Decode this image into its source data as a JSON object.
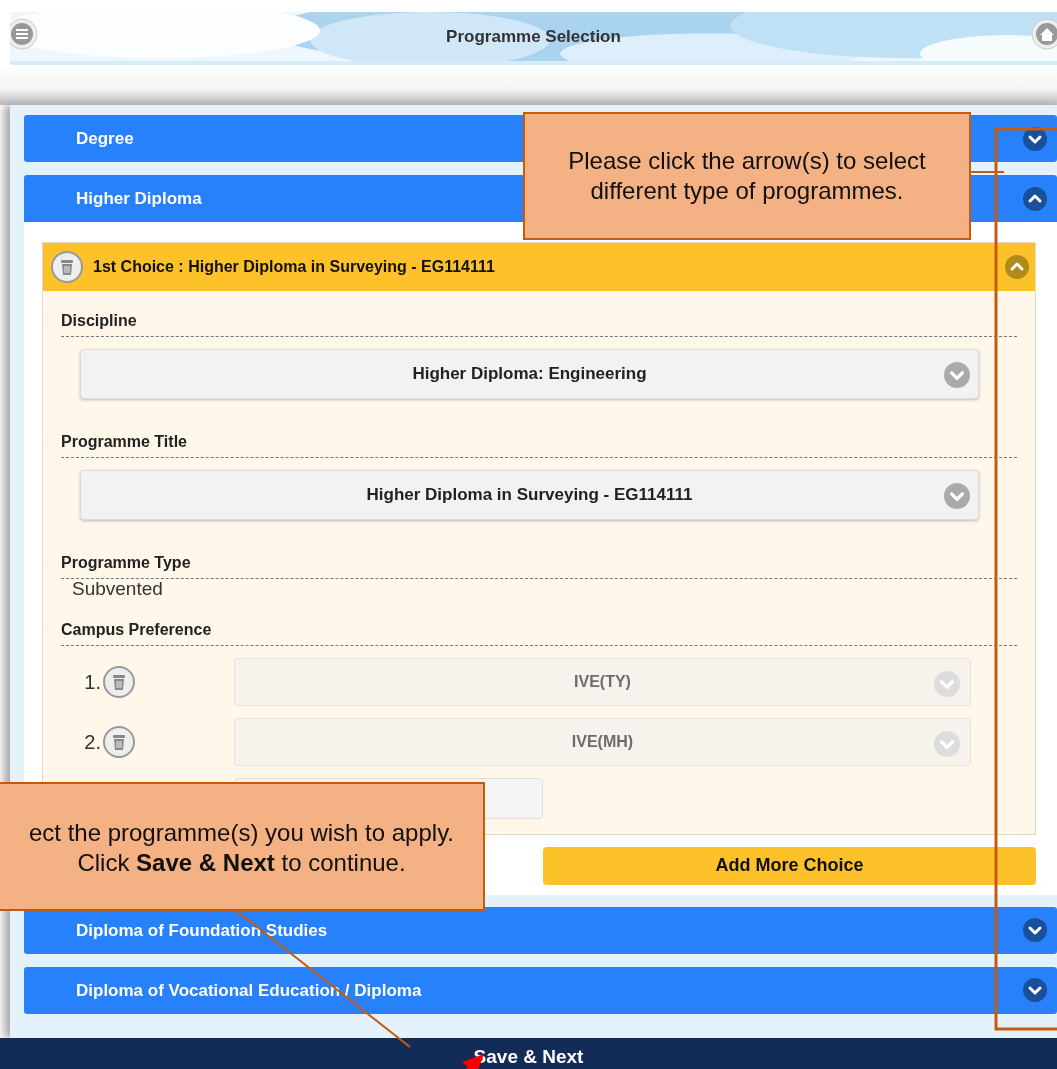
{
  "header": {
    "title": "Programme Selection"
  },
  "sections": [
    {
      "label": "Degree",
      "expanded": false
    },
    {
      "label": "Higher Diploma",
      "expanded": true,
      "choices": [
        {
          "title": "1st Choice : Higher Diploma in Surveying - EG114111",
          "expanded": true,
          "fields": [
            {
              "kind": "select",
              "label": "Discipline",
              "value": "Higher Diploma: Engineering"
            },
            {
              "kind": "select",
              "label": "Programme Title",
              "value": "Higher Diploma in Surveying - EG114111"
            },
            {
              "kind": "text",
              "label": "Programme Type",
              "value": "Subvented"
            },
            {
              "kind": "campus",
              "label": "Campus Preference",
              "items": [
                {
                  "kind": "select",
                  "number": "1.",
                  "value": "IVE(TY)",
                  "disabled": true
                },
                {
                  "kind": "select",
                  "number": "2.",
                  "value": "IVE(MH)",
                  "disabled": true
                },
                {
                  "kind": "input"
                }
              ]
            }
          ]
        }
      ],
      "add_button": "Add More Choice"
    },
    {
      "label": "Diploma of Foundation Studies",
      "expanded": false
    },
    {
      "label": "Diploma of Vocational Education / Diploma",
      "expanded": false
    }
  ],
  "footer_button": "Save & Next",
  "callouts": [
    {
      "text": "Please click the arrow(s) to select\ndifferent type of programmes."
    },
    {
      "text": "ect the programme(s) you wish to apply.\nClick **Save & Next** to continue."
    }
  ]
}
